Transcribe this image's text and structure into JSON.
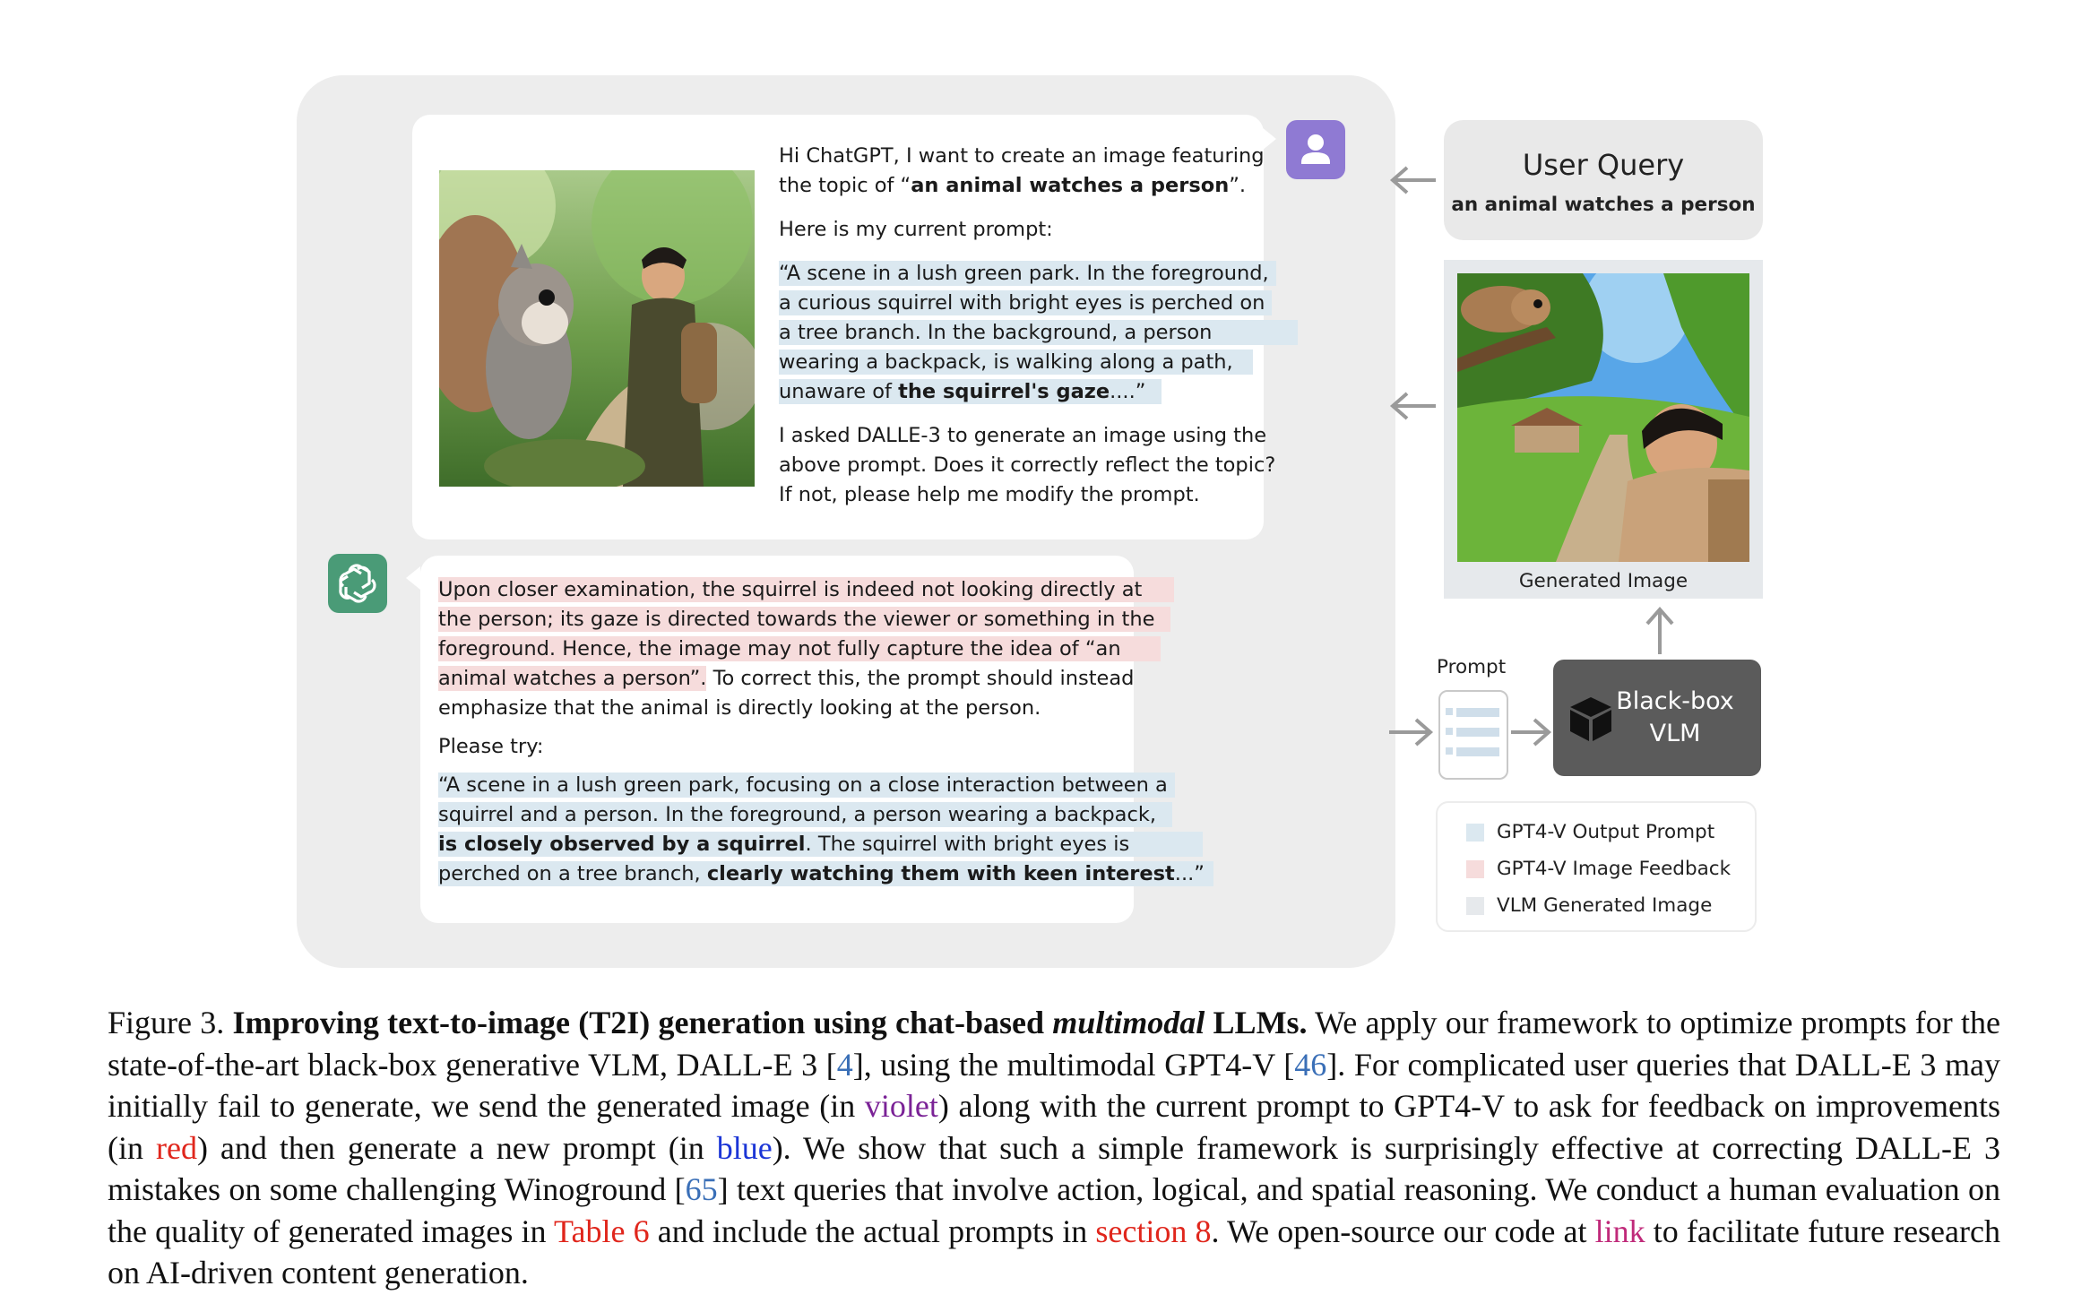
{
  "user_msg": {
    "intro_1": "Hi ChatGPT, I want to create an image featuring",
    "intro_2a": "the topic of “",
    "intro_2b": "an animal watches a person",
    "intro_2c": "”.",
    "current_prompt_label": "Here is my current prompt:",
    "prompt_lines": [
      "“A scene in a lush green park. In the foreground,",
      "a curious squirrel with bright eyes is perched on",
      "a tree branch. In the background, a person",
      "wearing a backpack, is walking along a path,"
    ],
    "prompt_last_a": "unaware of ",
    "prompt_last_b": "the squirrel's gaze",
    "prompt_last_c": "....”",
    "question_lines": [
      "I asked DALLE-3 to generate an image using the",
      "above prompt. Does it correctly reflect the topic?",
      "If not, please help me modify the prompt."
    ]
  },
  "gpt_msg": {
    "feedback_lines": [
      "Upon closer examination, the squirrel is indeed not looking directly at",
      "the person; its gaze is directed towards the viewer or something in the",
      "foreground. Hence, the image may not fully capture the idea of “an"
    ],
    "feedback_last_hl": "animal watches a person”.",
    "feedback_last_rest": " To correct this, the prompt should instead",
    "feedback_end": "emphasize that the animal is directly looking at the person.",
    "please_try": "Please try:",
    "new_line_1": "“A scene in a lush green park, focusing on a close interaction between a",
    "new_line_2": "squirrel and a person. In the foreground, a person wearing a backpack,",
    "new_line_3_bold": "is closely observed by a squirrel",
    "new_line_3_rest": ". The squirrel with bright eyes is",
    "new_line_4_a": "perched on a tree branch, ",
    "new_line_4_bold": "clearly watching them with keen interest",
    "new_line_4_c": "...”"
  },
  "user_query": {
    "title": "User Query",
    "subtitle": "an animal watches a person"
  },
  "generated_image_label": "Generated Image",
  "prompt_label": "Prompt",
  "vlm_box": {
    "line1": "Black-box",
    "line2": "VLM"
  },
  "legend": [
    {
      "label": "GPT4-V Output Prompt",
      "color": "#dbe8f0"
    },
    {
      "label": "GPT4-V Image Feedback",
      "color": "#f6dcdc"
    },
    {
      "label": "VLM Generated Image",
      "color": "#e6e9ec"
    }
  ],
  "colors": {
    "user_avatar": "#8f7ad3",
    "gpt_avatar": "#4a9b77",
    "vlm_box": "#5b5b5b",
    "arrow": "#9a9a9a"
  },
  "caption": {
    "fig_label": "Figure 3. ",
    "bold_1": "Improving text-to-image (T2I) generation using chat-based ",
    "bold_italic": "multimodal",
    "bold_2": " LLMs.",
    "t1": " We apply our framework to optimize prompts for the state-of-the-art black-box generative VLM, DALL-E 3 [",
    "ref_4": "4",
    "t2": "], using the multimodal GPT4-V [",
    "ref_46": "46",
    "t3": "]. For complicated user queries that DALL-E 3 may initially fail to generate, we send the generated image (in ",
    "violet": "violet",
    "t4": ") along with the current prompt to GPT4-V to ask for feedback on improvements (in ",
    "red": "red",
    "t5": ") and then generate a new prompt (in ",
    "blue": "blue",
    "t6": "). We show that such a simple framework is surprisingly effective at correcting DALL-E 3 mistakes on some challenging Winoground [",
    "ref_65": "65",
    "t7": "] text queries that involve action, logical, and spatial reasoning. We conduct a human evaluation on the quality of generated images in ",
    "table_ref": "Table 6",
    "t8": " and include the actual prompts in ",
    "section_ref": "section 8",
    "t9": ". We open-source our code at ",
    "link": "link",
    "t10": " to facilitate future research on AI-driven content generation."
  }
}
